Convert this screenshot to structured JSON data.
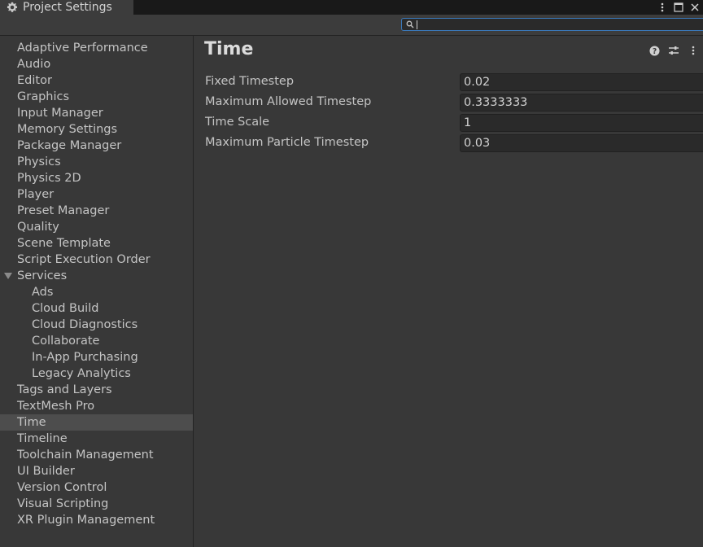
{
  "window": {
    "tab_title": "Project Settings"
  },
  "search": {
    "value": ""
  },
  "sidebar": {
    "items": [
      {
        "label": "Adaptive Performance"
      },
      {
        "label": "Audio"
      },
      {
        "label": "Editor"
      },
      {
        "label": "Graphics"
      },
      {
        "label": "Input Manager"
      },
      {
        "label": "Memory Settings"
      },
      {
        "label": "Package Manager"
      },
      {
        "label": "Physics"
      },
      {
        "label": "Physics 2D"
      },
      {
        "label": "Player"
      },
      {
        "label": "Preset Manager"
      },
      {
        "label": "Quality"
      },
      {
        "label": "Scene Template"
      },
      {
        "label": "Script Execution Order"
      },
      {
        "label": "Services",
        "expanded": true
      },
      {
        "label": "Ads",
        "child": true
      },
      {
        "label": "Cloud Build",
        "child": true
      },
      {
        "label": "Cloud Diagnostics",
        "child": true
      },
      {
        "label": "Collaborate",
        "child": true
      },
      {
        "label": "In-App Purchasing",
        "child": true
      },
      {
        "label": "Legacy Analytics",
        "child": true
      },
      {
        "label": "Tags and Layers"
      },
      {
        "label": "TextMesh Pro"
      },
      {
        "label": "Time",
        "selected": true
      },
      {
        "label": "Timeline"
      },
      {
        "label": "Toolchain Management"
      },
      {
        "label": "UI Builder"
      },
      {
        "label": "Version Control"
      },
      {
        "label": "Visual Scripting"
      },
      {
        "label": "XR Plugin Management"
      }
    ]
  },
  "main": {
    "title": "Time",
    "properties": [
      {
        "label": "Fixed Timestep",
        "value": "0.02"
      },
      {
        "label": "Maximum Allowed Timestep",
        "value": "0.3333333"
      },
      {
        "label": "Time Scale",
        "value": "1"
      },
      {
        "label": "Maximum Particle Timestep",
        "value": "0.03"
      }
    ]
  },
  "colors": {
    "background": "#383838",
    "selected_row": "#4d4d4d",
    "search_border": "#3a79bb",
    "field_bg": "#2a2a2a"
  },
  "icons": {
    "tab": "gear-icon",
    "window": [
      "kebab-menu-icon",
      "maximize-icon",
      "close-icon"
    ],
    "search": "search-icon",
    "header": [
      "help-icon",
      "presets-icon",
      "more-options-icon"
    ]
  }
}
